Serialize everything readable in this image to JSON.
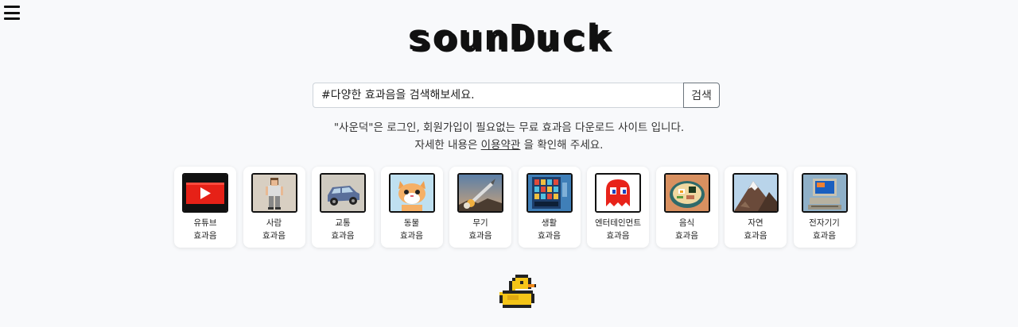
{
  "header": {
    "logo_text": "sounDuck"
  },
  "search": {
    "placeholder": "#다양한 효과음을 검색해보세요.",
    "button_label": "검색"
  },
  "notice": {
    "line1": "\"사운덕\"은 로그인, 회원가입이 필요없는 무료 효과음 다운로드 사이트 입니다.",
    "line2_prefix": "자세한 내용은 ",
    "terms_link": "이용약관",
    "line2_suffix": " 을 확인해 주세요."
  },
  "categories": [
    {
      "name": "유튜브",
      "sub": "효과음",
      "icon": "youtube-icon"
    },
    {
      "name": "사람",
      "sub": "효과음",
      "icon": "person-icon"
    },
    {
      "name": "교통",
      "sub": "효과음",
      "icon": "car-icon"
    },
    {
      "name": "동물",
      "sub": "효과음",
      "icon": "cat-icon"
    },
    {
      "name": "무기",
      "sub": "효과음",
      "icon": "missile-icon"
    },
    {
      "name": "생활",
      "sub": "효과음",
      "icon": "vending-machine-icon"
    },
    {
      "name": "엔터테인먼트",
      "sub": "효과음",
      "icon": "pacman-ghost-icon"
    },
    {
      "name": "음식",
      "sub": "효과음",
      "icon": "ramen-icon"
    },
    {
      "name": "자연",
      "sub": "효과음",
      "icon": "mountain-icon"
    },
    {
      "name": "전자기기",
      "sub": "효과음",
      "icon": "computer-icon"
    }
  ],
  "colors": {
    "background": "#f8f9fb",
    "youtube_red": "#e62117",
    "duck_yellow": "#f5c518"
  }
}
